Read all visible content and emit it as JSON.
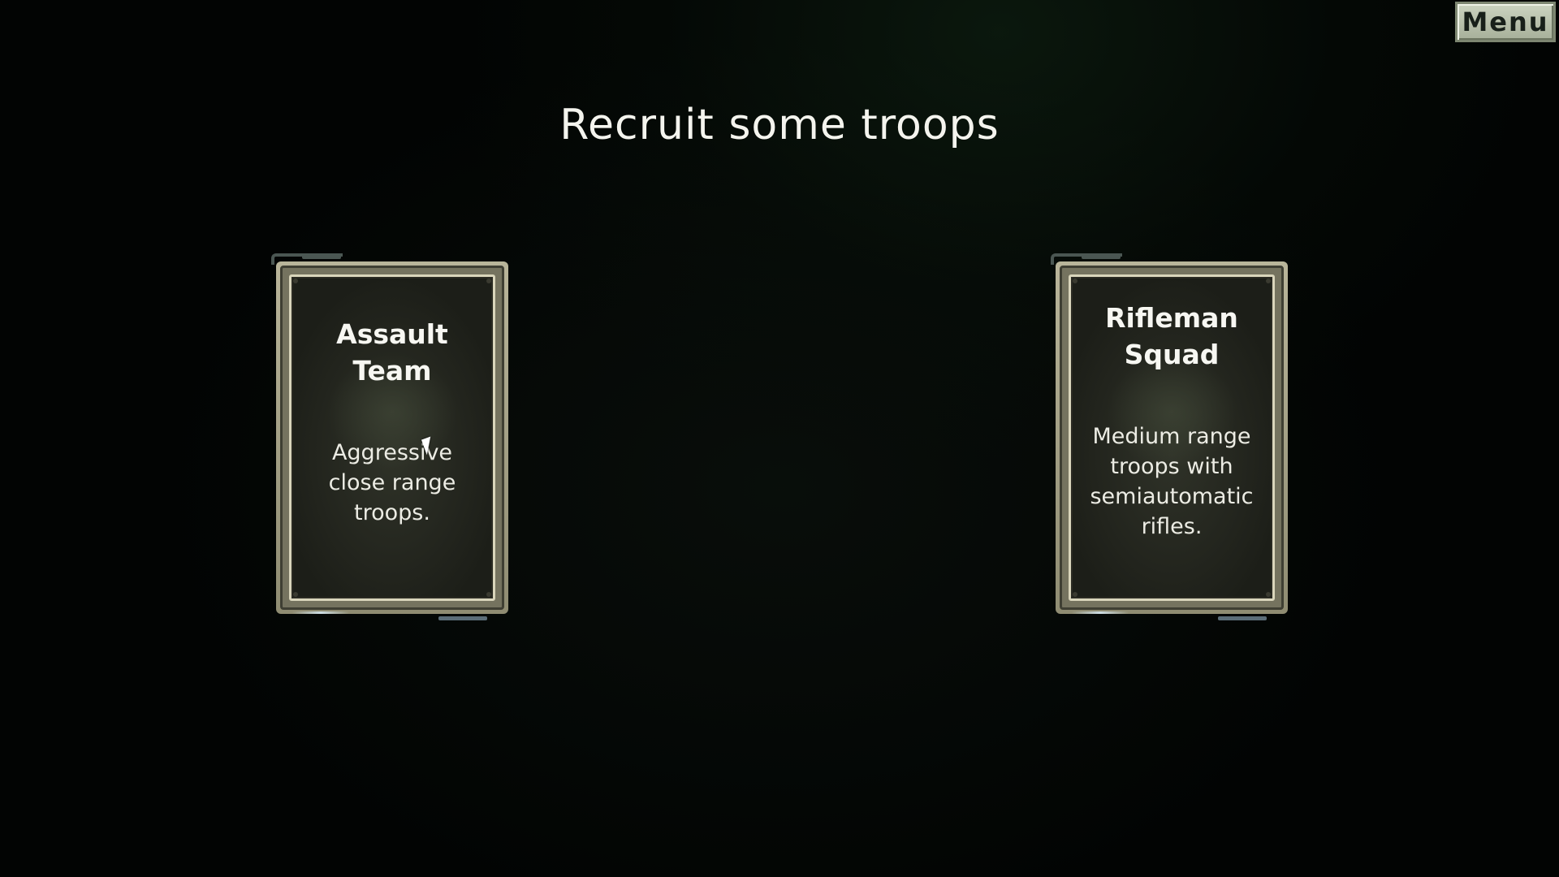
{
  "menu": {
    "label": "Menu"
  },
  "screen": {
    "title": "Recruit some troops"
  },
  "cards": [
    {
      "name": "Assault Team",
      "description": "Aggressive close range troops."
    },
    {
      "name": "Rifleman Squad",
      "description": "Medium range troops with semiautomatic rifles."
    }
  ]
}
